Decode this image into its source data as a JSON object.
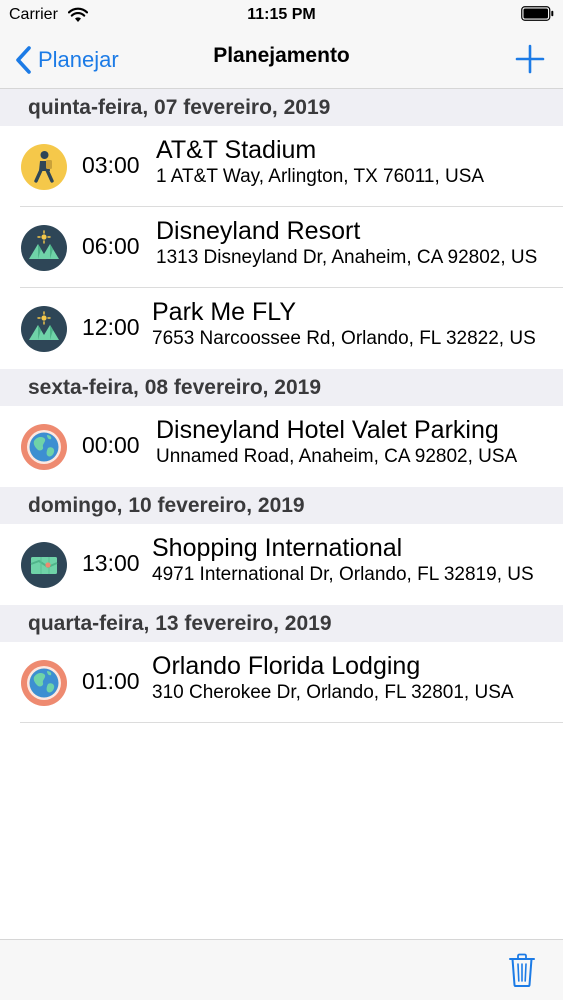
{
  "status_bar": {
    "carrier": "Carrier",
    "time": "11:15 PM"
  },
  "nav": {
    "back_label": "Planejar",
    "title": "Planejamento"
  },
  "colors": {
    "accent": "#1c7be6",
    "section_background": "#efeff4",
    "icon_yellow": "#f5c84a",
    "icon_navy": "#2e4657",
    "icon_coral": "#ee8a70"
  },
  "sections": [
    {
      "header": "quinta-feira, 07 fevereiro, 2019",
      "items": [
        {
          "icon": "hiker-icon",
          "time": "03:00",
          "title": "AT&T Stadium",
          "address": "1 AT&T Way, Arlington, TX 76011, USA"
        },
        {
          "icon": "mountain-icon",
          "time": "06:00",
          "title": "Disneyland Resort",
          "address": "1313 Disneyland Dr, Anaheim, CA 92802, US"
        },
        {
          "icon": "mountain-icon",
          "time": "12:00",
          "title": "Park Me FLY",
          "address": "7653 Narcoossee Rd, Orlando, FL 32822, US"
        }
      ]
    },
    {
      "header": "sexta-feira, 08 fevereiro, 2019",
      "items": [
        {
          "icon": "globe-icon",
          "time": "00:00",
          "title": "Disneyland Hotel Valet Parking",
          "address": "Unnamed Road, Anaheim, CA 92802, USA"
        }
      ]
    },
    {
      "header": "domingo, 10 fevereiro, 2019",
      "items": [
        {
          "icon": "map-icon",
          "time": "13:00",
          "title": "Shopping International",
          "address": "4971 International Dr, Orlando, FL 32819, US"
        }
      ]
    },
    {
      "header": "quarta-feira, 13 fevereiro, 2019",
      "items": [
        {
          "icon": "globe-icon",
          "time": "01:00",
          "title": "Orlando Florida Lodging",
          "address": "310 Cherokee Dr, Orlando, FL 32801, USA"
        }
      ]
    }
  ],
  "toolbar": {
    "trash_icon": "trash-icon"
  }
}
